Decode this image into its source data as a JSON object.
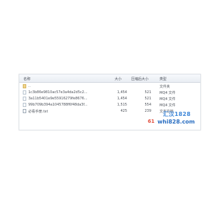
{
  "columns": {
    "name": "名称",
    "size": "大小",
    "compressed_size": "压缩后大小",
    "type": "类型"
  },
  "files": [
    {
      "name": "..",
      "size": "",
      "compressed_size": "",
      "type": "文件夹",
      "icon": "folder-icon"
    },
    {
      "name": "1c3b86e9810ac57e3a4da2d5c2...",
      "size": "1,454",
      "compressed_size": "521",
      "type": "MQ4 文件",
      "icon": "file-icon"
    },
    {
      "name": "3a11b5401e9e55916279fe8676...",
      "size": "1,454",
      "compressed_size": "521",
      "type": "MQ4 文件",
      "icon": "file-icon"
    },
    {
      "name": "99b709b394a1045788f6f48da3f...",
      "size": "1,515",
      "compressed_size": "554",
      "type": "MQ4 文件",
      "icon": "file-icon"
    },
    {
      "name": "必看手册.txt",
      "size": "425",
      "compressed_size": "239",
      "type": "文本文档",
      "icon": "text-file-icon"
    }
  ],
  "watermark": {
    "line1": "汇汉1828",
    "line2": "whi828.com",
    "prefix": "61"
  }
}
